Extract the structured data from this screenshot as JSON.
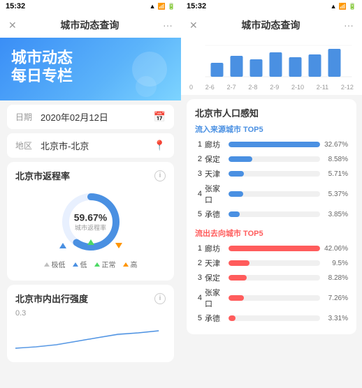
{
  "left": {
    "statusBar": {
      "time": "15:32"
    },
    "headerTitle": "城市动态查询",
    "hero": {
      "line1": "城市动态",
      "line2": "每日专栏"
    },
    "dateField": {
      "label": "日期",
      "value": "2020年02月12日"
    },
    "regionField": {
      "label": "地区",
      "value": "北京市-北京"
    },
    "returnCard": {
      "title": "北京市返程率",
      "percent": "59.67%",
      "subLabel": "城市返程率"
    },
    "legend": {
      "items": [
        "极低",
        "低",
        "正常",
        "高"
      ]
    },
    "mobilityCard": {
      "title": "北京市内出行强度",
      "value": "0.3"
    }
  },
  "right": {
    "statusBar": {
      "time": "15:32"
    },
    "headerTitle": "城市动态查询",
    "topChart": {
      "axisLabels": [
        "0",
        "2-6",
        "2-7",
        "2-8",
        "2-9",
        "2-10",
        "2-11",
        "2-12"
      ]
    },
    "populationSection": {
      "title": "北京市人口感知",
      "inflow": {
        "subtitle": "流入来源城市 TOP5",
        "items": [
          {
            "rank": "1",
            "name": "廊坊",
            "value": "32.67%",
            "pct": 100
          },
          {
            "rank": "2",
            "name": "保定",
            "value": "8.58%",
            "pct": 26
          },
          {
            "rank": "3",
            "name": "天津",
            "value": "5.71%",
            "pct": 17
          },
          {
            "rank": "4",
            "name": "张家口",
            "value": "5.37%",
            "pct": 16
          },
          {
            "rank": "5",
            "name": "承德",
            "value": "3.85%",
            "pct": 12
          }
        ]
      },
      "outflow": {
        "subtitle": "流出去向城市 TOP5",
        "items": [
          {
            "rank": "1",
            "name": "廊坊",
            "value": "42.06%",
            "pct": 100
          },
          {
            "rank": "2",
            "name": "天津",
            "value": "9.5%",
            "pct": 23
          },
          {
            "rank": "3",
            "name": "保定",
            "value": "8.28%",
            "pct": 20
          },
          {
            "rank": "4",
            "name": "张家口",
            "value": "7.26%",
            "pct": 17
          },
          {
            "rank": "5",
            "name": "承德",
            "value": "3.31%",
            "pct": 8
          }
        ]
      }
    }
  },
  "colors": {
    "primary": "#4a90e2",
    "inflow": "#4a90e2",
    "outflow": "#ff5c5c",
    "donut": "#4a90e2",
    "donutBg": "#e8f0fe"
  }
}
